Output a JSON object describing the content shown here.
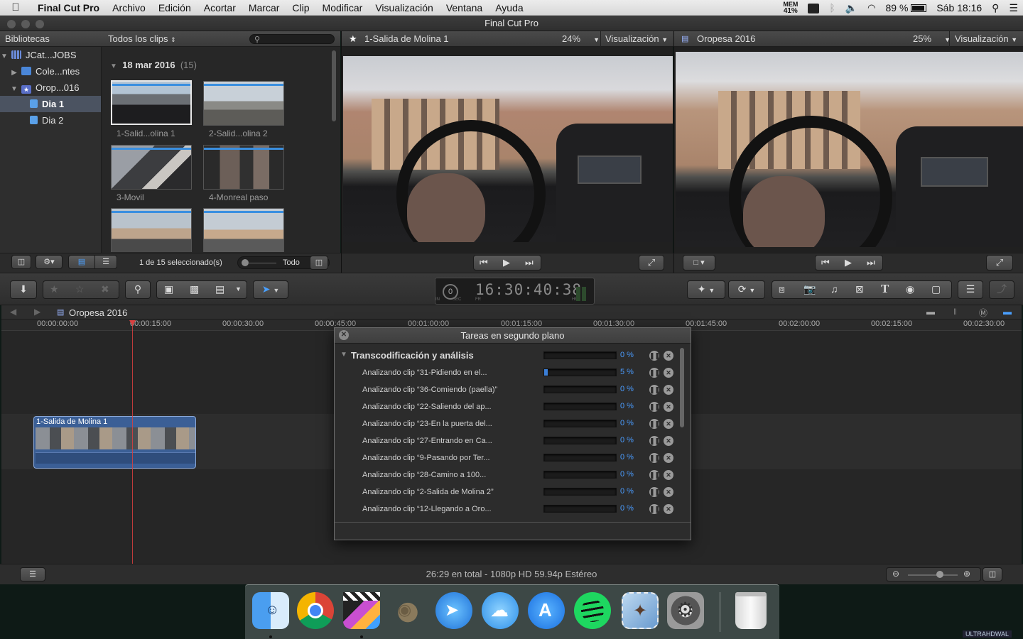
{
  "menubar": {
    "apple": "",
    "app_name": "Final Cut Pro",
    "items": [
      "Archivo",
      "Edición",
      "Acortar",
      "Marcar",
      "Clip",
      "Modificar",
      "Visualización",
      "Ventana",
      "Ayuda"
    ],
    "mem_label": "MEM",
    "mem_value": "41%",
    "battery": "89 %",
    "clock": "Sáb 18:16"
  },
  "window": {
    "title": "Final Cut Pro"
  },
  "library": {
    "header": "Bibliotecas",
    "items": [
      {
        "label": "JCat...JOBS"
      },
      {
        "label": "Cole...ntes"
      },
      {
        "label": "Orop...016"
      },
      {
        "label": "Dia 1"
      },
      {
        "label": "Dia 2"
      }
    ]
  },
  "browser": {
    "filter": "Todos los clips",
    "date_group": "18 mar 2016",
    "date_count": "(15)",
    "clips": [
      {
        "label": "1-Salid...olina 1"
      },
      {
        "label": "2-Salid...olina 2"
      },
      {
        "label": "3-Movil"
      },
      {
        "label": "4-Monreal paso"
      },
      {
        "label": ""
      },
      {
        "label": ""
      }
    ],
    "status": "1 de 15 seleccionado(s)",
    "all_label": "Todo"
  },
  "viewer1": {
    "title": "1-Salida de Molina 1",
    "zoom": "24%",
    "view_label": "Visualización"
  },
  "viewer2": {
    "title": "Oropesa 2016",
    "zoom": "25%",
    "view_label": "Visualización"
  },
  "timecode": {
    "value": "16:30:40:38",
    "units": [
      "IN",
      "SEC",
      "FR",
      "HR"
    ],
    "big_zero": "0"
  },
  "timeline": {
    "project": "Oropesa 2016",
    "ruler": [
      "00:00:00:00",
      "00:00:15:00",
      "00:00:30:00",
      "00:00:45:00",
      "00:01:00:00",
      "00:01:15:00",
      "00:01:30:00",
      "00:01:45:00",
      "00:02:00:00",
      "00:02:15:00",
      "00:02:30:00"
    ],
    "clip_label": "1-Salida de Molina 1",
    "footer": "26:29 en total - 1080p HD 59.94p Estéreo"
  },
  "background_tasks": {
    "title": "Tareas en segundo plano",
    "group_label": "Transcodificación y análisis",
    "group_pct": "0 %",
    "tasks": [
      {
        "label": "Analizando clip “31-Pidiendo en el...",
        "pct": "5 %",
        "progress": 0.05
      },
      {
        "label": "Analizando clip “36-Comiendo (paella)”",
        "pct": "0 %",
        "progress": 0
      },
      {
        "label": "Analizando clip “22-Saliendo del ap...",
        "pct": "0 %",
        "progress": 0
      },
      {
        "label": "Analizando clip “23-En la puerta del...",
        "pct": "0 %",
        "progress": 0
      },
      {
        "label": "Analizando clip “27-Entrando en Ca...",
        "pct": "0 %",
        "progress": 0
      },
      {
        "label": "Analizando clip “9-Pasando por Ter...",
        "pct": "0 %",
        "progress": 0
      },
      {
        "label": "Analizando clip “28-Camino a 100...",
        "pct": "0 %",
        "progress": 0
      },
      {
        "label": "Analizando clip “2-Salida de Molina 2”",
        "pct": "0 %",
        "progress": 0
      },
      {
        "label": "Analizando clip “12-Llegando a Oro...",
        "pct": "0 %",
        "progress": 0
      }
    ]
  },
  "dock": {
    "apps": [
      "Finder",
      "Google Chrome",
      "Final Cut Pro",
      "GIMP",
      "Mail",
      "Mensajes",
      "App Store",
      "Spotify",
      "Photo Mail",
      "Preferencias del Sistema",
      "Papelera"
    ]
  },
  "watermark": "ULTRAHDWAL"
}
